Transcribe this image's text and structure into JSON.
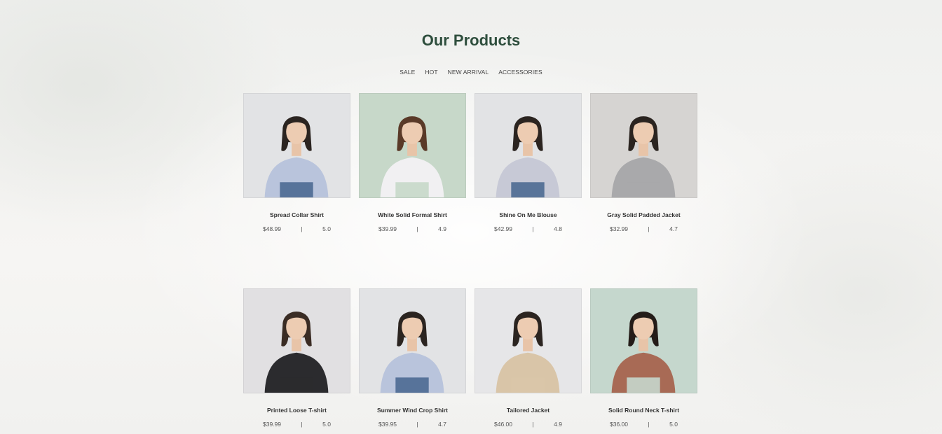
{
  "section": {
    "title": "Our Products"
  },
  "tabs": [
    "SALE",
    "HOT",
    "NEW ARRIVAL",
    "ACCESSORIES"
  ],
  "separator": "|",
  "products": [
    {
      "name": "Spread Collar Shirt",
      "price": "$48.99",
      "rating": "5.0",
      "bg": "#e2e3e5",
      "hair": "#2b2420",
      "top": "#b9c4dc",
      "bottom": "#4d6a92"
    },
    {
      "name": "White Solid Formal Shirt",
      "price": "$39.99",
      "rating": "4.9",
      "bg": "#c7d8c9",
      "hair": "#5a3a28",
      "top": "#f1f0f2",
      "bottom": "#c7d8c9"
    },
    {
      "name": "Shine On Me Blouse",
      "price": "$42.99",
      "rating": "4.8",
      "bg": "#e2e3e5",
      "hair": "#2b2420",
      "top": "#c7c9d6",
      "bottom": "#4d6a92"
    },
    {
      "name": "Gray Solid Padded Jacket",
      "price": "$32.99",
      "rating": "4.7",
      "bg": "#d6d4d2",
      "hair": "#2b2420",
      "top": "#a9a9ab",
      "bottom": "#a9a9ab"
    },
    {
      "name": "Printed Loose T-shirt",
      "price": "$39.99",
      "rating": "5.0",
      "bg": "#e1e0e2",
      "hair": "#3a2c24",
      "top": "#2b2b2e",
      "bottom": "#2b2b2e"
    },
    {
      "name": "Summer Wind Crop Shirt",
      "price": "$39.95",
      "rating": "4.7",
      "bg": "#e2e3e5",
      "hair": "#2b2420",
      "top": "#b9c4dc",
      "bottom": "#4d6a92"
    },
    {
      "name": "Tailored Jacket",
      "price": "$46.00",
      "rating": "4.9",
      "bg": "#e6e6e8",
      "hair": "#2b2420",
      "top": "#d9c5a8",
      "bottom": "#d9c5a8"
    },
    {
      "name": "Solid Round Neck T-shirt",
      "price": "$36.00",
      "rating": "5.0",
      "bg": "#c5d7cd",
      "hair": "#241c18",
      "top": "#a86a55",
      "bottom": "#c5d7cd"
    }
  ]
}
